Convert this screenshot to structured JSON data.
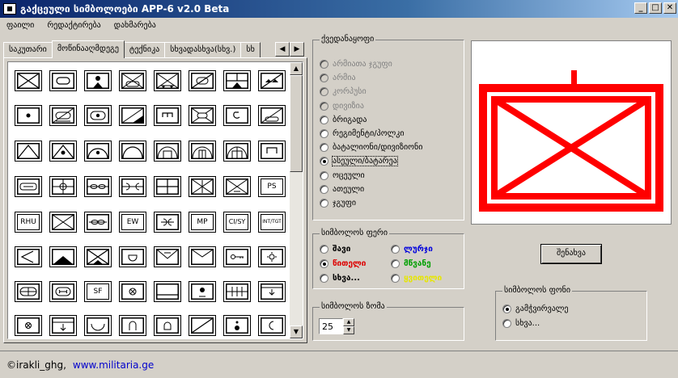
{
  "window": {
    "title": "გაქცეული სიმბოლოები APP-6  v2.0 Beta",
    "btn_min": "_",
    "btn_max": "□",
    "btn_close": "✕"
  },
  "menu": [
    "ფაილი",
    "რედაქტირება",
    "დახმარება"
  ],
  "tabs": {
    "items": [
      "საკუთარი",
      "მოწინააღმდეგე",
      "ტექნიკა",
      "სხვადასხვა(სხვ.)",
      "სხ"
    ],
    "active_index": 1,
    "left_arrow": "◀",
    "right_arrow": "▶"
  },
  "symbol_grid": {
    "text_symbols": {
      "ps": "PS",
      "rhu": "RHU",
      "ew": "EW",
      "mp": "MP",
      "cisy": "CI/SY",
      "intitgt": "INT/TGT",
      "sf": "SF"
    },
    "scroll_up": "▲",
    "scroll_down": "▼"
  },
  "echelon_group": {
    "label": "ქვედანაყოფი",
    "options": [
      {
        "label": "არმიათა ჯგუფი",
        "state": "disabled"
      },
      {
        "label": "არმია",
        "state": "disabled"
      },
      {
        "label": "კორპუსი",
        "state": "disabled"
      },
      {
        "label": "დივიზია",
        "state": "disabled"
      },
      {
        "label": "ბრიგადა",
        "state": "enabled"
      },
      {
        "label": "რეგიმენტი/პოლკი",
        "state": "enabled"
      },
      {
        "label": "ბატალიონი/დივიზიონი",
        "state": "enabled"
      },
      {
        "label": "ასეული/ბატარეა",
        "state": "checked"
      },
      {
        "label": "ოცეული",
        "state": "enabled"
      },
      {
        "label": "ათეული",
        "state": "enabled"
      },
      {
        "label": "ჯგუფი",
        "state": "enabled"
      }
    ]
  },
  "color_group": {
    "label": "სიმბოლოს ფერი",
    "options": [
      {
        "label": "შავი",
        "color": "#000000",
        "checked": false
      },
      {
        "label": "ლურჯი",
        "color": "#0000dd",
        "checked": false
      },
      {
        "label": "წითელი",
        "color": "#dd0000",
        "checked": true
      },
      {
        "label": "მწვანე",
        "color": "#00a000",
        "checked": false
      },
      {
        "label": "სხვა...",
        "color": "#000000",
        "checked": false
      },
      {
        "label": "ყვითელი",
        "color": "#e6e600",
        "checked": false
      }
    ]
  },
  "size_group": {
    "label": "სიმბოლოს ზომა",
    "value": "25",
    "up": "▲",
    "down": "▼"
  },
  "background_group": {
    "label": "სიმბოლოს ფონი",
    "options": [
      {
        "label": "გამჭვირვალე",
        "checked": true
      },
      {
        "label": "სხვა...",
        "checked": false
      }
    ]
  },
  "preview": {
    "symbol_color": "#ff0000"
  },
  "save_button": "შენახვა",
  "status": {
    "author": "©irakli_ghg,",
    "website": "www.militaria.ge"
  }
}
